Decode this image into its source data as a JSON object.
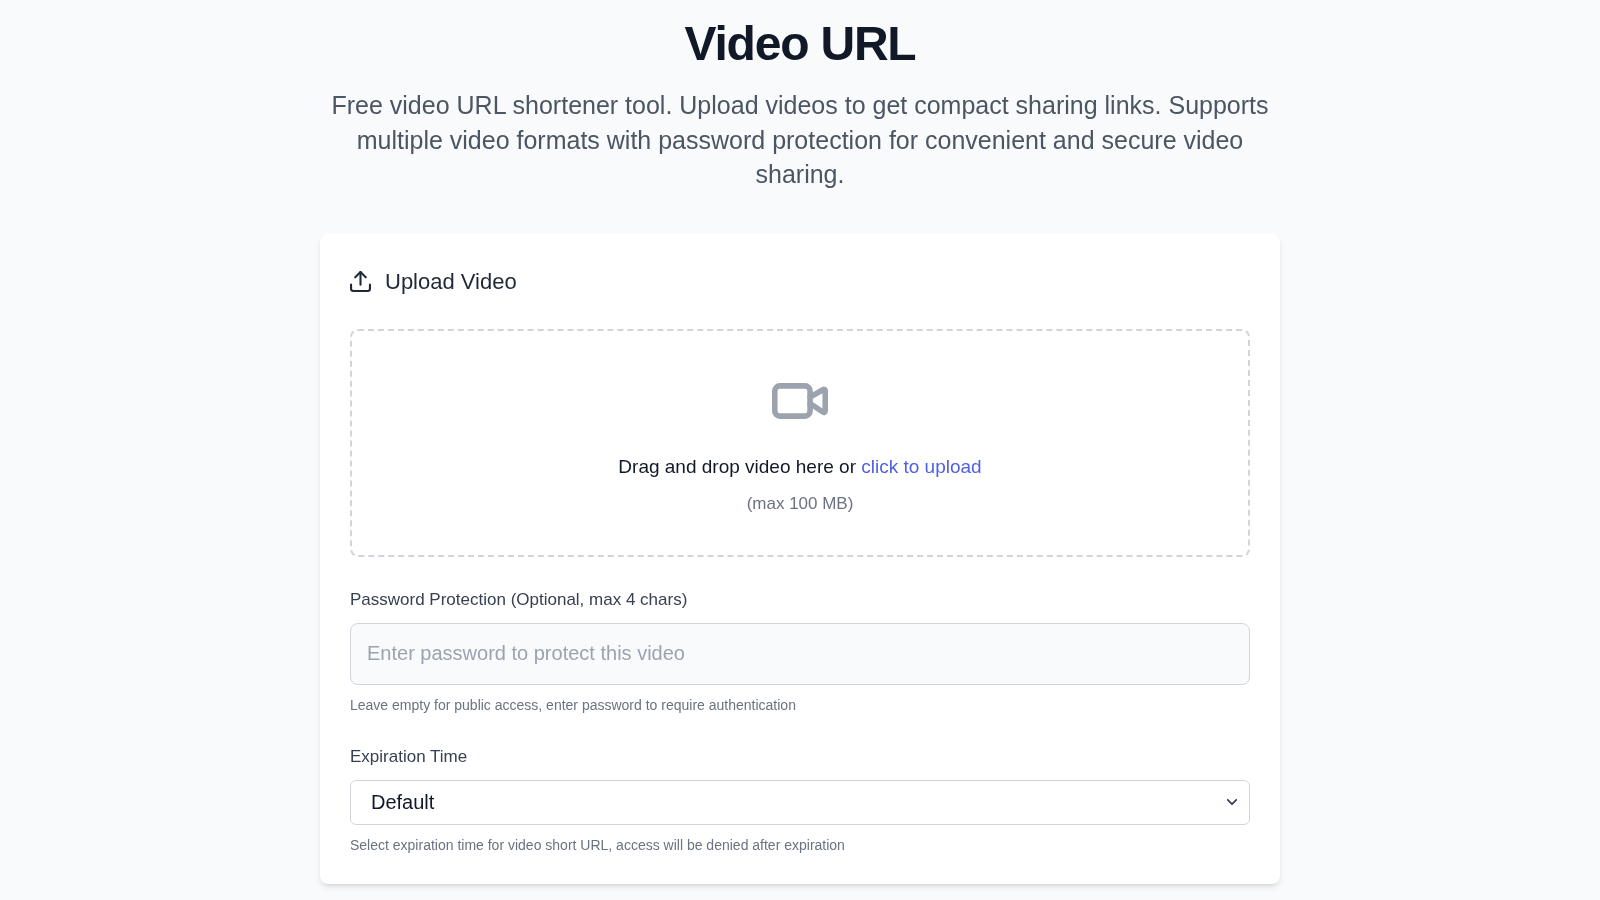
{
  "page": {
    "title": "Video URL",
    "description": "Free video URL shortener tool. Upload videos to get compact sharing links. Supports multiple video formats with password protection for convenient and secure video sharing."
  },
  "upload_card": {
    "title": "Upload Video",
    "dropzone": {
      "prompt": "Drag and drop video here or",
      "link": "click to upload",
      "size_limit": "(max 100 MB)"
    },
    "fields": [
      {
        "kind": "text",
        "label": "Password Protection (Optional, max 4 chars)",
        "placeholder": "Enter password to protect this video",
        "hint": "Leave empty for public access, enter password to require authentication"
      },
      {
        "kind": "select",
        "label": "Expiration Time",
        "value": "Default",
        "hint": "Select expiration time for video short URL, access will be denied after expiration"
      }
    ]
  }
}
